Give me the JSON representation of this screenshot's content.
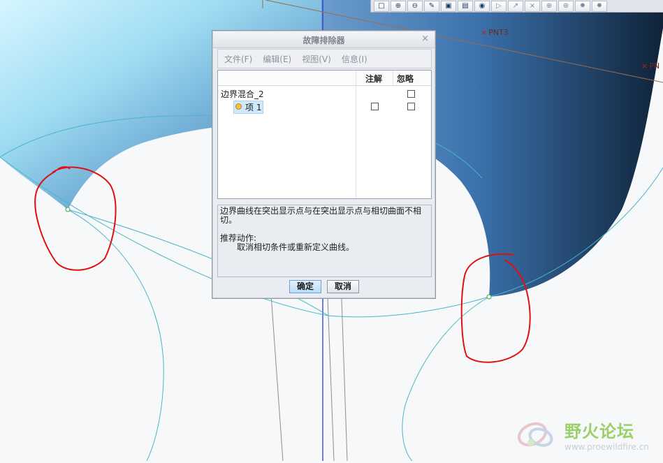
{
  "viewport": {
    "labels": {
      "pnt_a": "PNT3",
      "pnt_b": "PN"
    }
  },
  "toolbar": {
    "icons": [
      "zoom-window-icon",
      "zoom-in-icon",
      "zoom-out-icon",
      "repaint-icon",
      "shading-icon",
      "saved-views-icon",
      "camera-icon",
      "datum-planes-icon",
      "datum-axes-icon",
      "datum-points-icon",
      "coordinate-system-icon",
      "annotation-icon",
      "spin-center-icon",
      "display-style-icon"
    ]
  },
  "dialog": {
    "title": "故障排除器",
    "close": "×",
    "menu": [
      "文件(F)",
      "编辑(E)",
      "视图(V)",
      "信息(I)"
    ],
    "table": {
      "columns": [
        "注解",
        "忽略"
      ],
      "rows": [
        {
          "label": "边界混合_2",
          "level": 0
        },
        {
          "label": "项 1",
          "level": 1
        }
      ]
    },
    "message": {
      "description": "边界曲线在突出显示点与在突出显示点与相切曲面不相切。",
      "action_title": "推荐动作:",
      "action": "取消相切条件或重新定义曲线。"
    },
    "buttons": {
      "ok": "确定",
      "cancel": "取消"
    }
  },
  "watermark": {
    "title": "野火论坛",
    "url": "www.proewildfire.cn"
  },
  "colors": {
    "surface_light": "#bfeafb",
    "surface_mid": "#3f78b6",
    "surface_dark": "#10283f",
    "curve": "#49b6c9",
    "highlight_circle": "#e01010"
  }
}
